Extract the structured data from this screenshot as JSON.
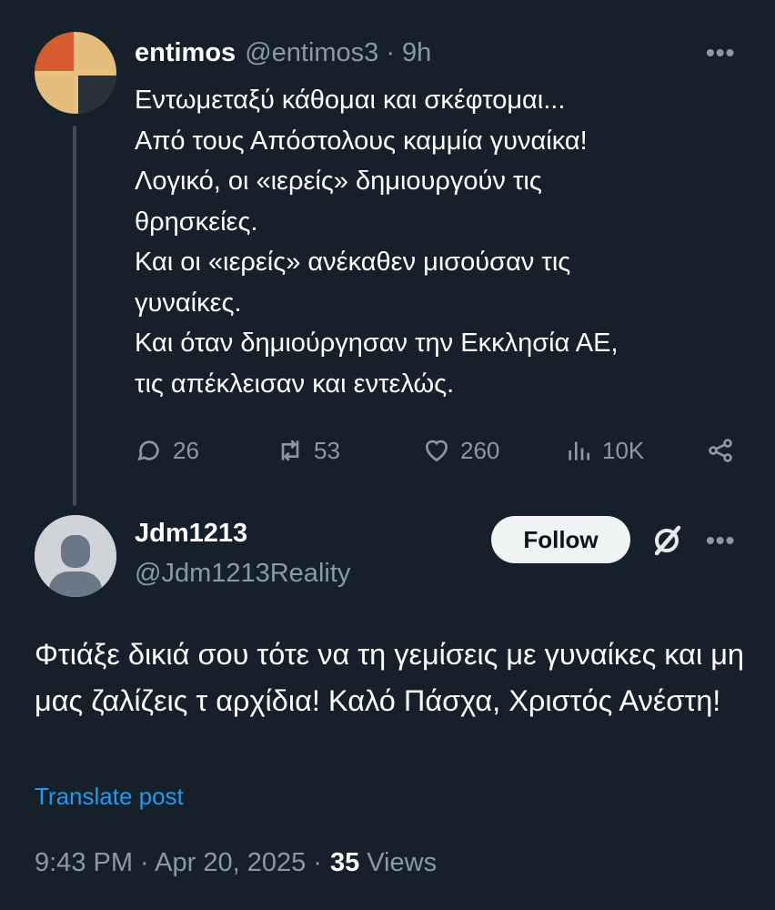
{
  "parent": {
    "author_name": "entimos",
    "author_handle": "@entimos3",
    "separator": "·",
    "time": "9h",
    "more": "•••",
    "text": "Εντωμεταξύ κάθομαι και σκέφτομαι...\nΑπό τους Απόστολους καμμία γυναίκα!\nΛογικό, οι «ιερείς» δημιουργούν τις\nθρησκείες.\nΚαι οι «ιερείς» ανέκαθεν μισούσαν τις\nγυναίκες.\nΚαι όταν δημιούργησαν την Εκκλησία ΑΕ,\nτις απέκλεισαν και εντελώς.",
    "actions": {
      "replies": "26",
      "reposts": "53",
      "likes": "260",
      "views": "10K"
    },
    "avatar_icon": "mondrian-avatar"
  },
  "reply": {
    "author_name": "Jdm1213",
    "author_handle": "@Jdm1213Reality",
    "follow_label": "Follow",
    "more": "•••",
    "text": "Φτιάξε δικιά σου τότε να τη γεμίσεις με γυναίκες και μη μας ζαλίζεις τ αρχίδια! Καλό Πάσχα, Χριστός Ανέστη!",
    "translate_label": "Translate post",
    "timestamp": "9:43 PM · Apr 20, 2025 ·",
    "views_count": "35",
    "views_label": "Views",
    "avatar_icon": "default-avatar"
  },
  "colors": {
    "background": "#15202b",
    "secondary_text": "#8b98a5",
    "link": "#1d9bf0"
  }
}
